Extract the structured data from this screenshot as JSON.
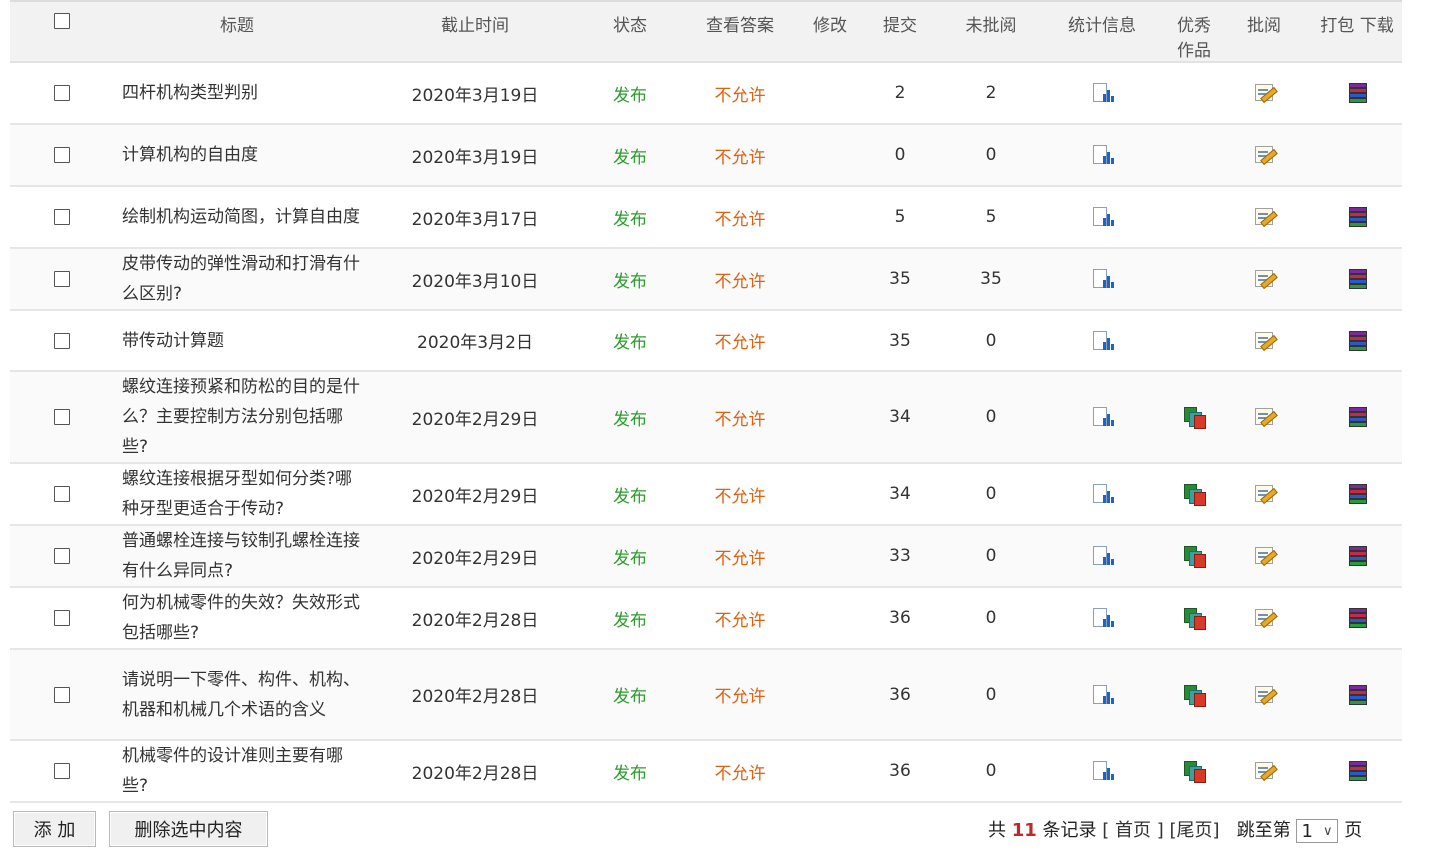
{
  "header": {
    "title": "标题",
    "deadline": "截止时间",
    "status": "状态",
    "view_answer": "查看答案",
    "edit": "修改",
    "submitted": "提交",
    "unreviewed": "未批阅",
    "stats": "统计信息",
    "excellent": "优秀作品",
    "review": "批阅",
    "pack": "打包 下载"
  },
  "rows": [
    {
      "title": "四杆机构类型判别",
      "deadline": "2020年3月19日",
      "status": "发布",
      "answer": "不允许",
      "submitted": "2",
      "unreviewed": "2",
      "excellent": false,
      "pack": true
    },
    {
      "title": "计算机构的自由度",
      "deadline": "2020年3月19日",
      "status": "发布",
      "answer": "不允许",
      "submitted": "0",
      "unreviewed": "0",
      "excellent": false,
      "pack": false
    },
    {
      "title": "绘制机构运动简图，计算自由度",
      "deadline": "2020年3月17日",
      "status": "发布",
      "answer": "不允许",
      "submitted": "5",
      "unreviewed": "5",
      "excellent": false,
      "pack": true
    },
    {
      "title": "皮带传动的弹性滑动和打滑有什么区别?",
      "deadline": "2020年3月10日",
      "status": "发布",
      "answer": "不允许",
      "submitted": "35",
      "unreviewed": "35",
      "excellent": false,
      "pack": true
    },
    {
      "title": "带传动计算题",
      "deadline": "2020年3月2日",
      "status": "发布",
      "answer": "不允许",
      "submitted": "35",
      "unreviewed": "0",
      "excellent": false,
      "pack": true
    },
    {
      "title": "螺纹连接预紧和防松的目的是什么？主要控制方法分别包括哪些?",
      "deadline": "2020年2月29日",
      "status": "发布",
      "answer": "不允许",
      "submitted": "34",
      "unreviewed": "0",
      "excellent": true,
      "pack": true
    },
    {
      "title": "螺纹连接根据牙型如何分类?哪种牙型更适合于传动?",
      "deadline": "2020年2月29日",
      "status": "发布",
      "answer": "不允许",
      "submitted": "34",
      "unreviewed": "0",
      "excellent": true,
      "pack": true
    },
    {
      "title": "普通螺栓连接与铰制孔螺栓连接有什么异同点?",
      "deadline": "2020年2月29日",
      "status": "发布",
      "answer": "不允许",
      "submitted": "33",
      "unreviewed": "0",
      "excellent": true,
      "pack": true
    },
    {
      "title": "何为机械零件的失效？失效形式包括哪些?",
      "deadline": "2020年2月28日",
      "status": "发布",
      "answer": "不允许",
      "submitted": "36",
      "unreviewed": "0",
      "excellent": true,
      "pack": true
    },
    {
      "title": "请说明一下零件、构件、机构、机器和机械几个术语的含义",
      "deadline": "2020年2月28日",
      "status": "发布",
      "answer": "不允许",
      "submitted": "36",
      "unreviewed": "0",
      "excellent": true,
      "pack": true
    },
    {
      "title": "机械零件的设计准则主要有哪些?",
      "deadline": "2020年2月28日",
      "status": "发布",
      "answer": "不允许",
      "submitted": "36",
      "unreviewed": "0",
      "excellent": true,
      "pack": true
    }
  ],
  "footer": {
    "add_label": "添 加",
    "delete_label": "删除选中内容",
    "total_prefix": "共",
    "total_count": "11",
    "total_suffix": "条记录",
    "first_page": "[ 首页 ]",
    "last_page": "[尾页]",
    "jump_prefix": "跳至第",
    "page_value": "1",
    "jump_suffix": "页"
  },
  "colors": {
    "status": "#2a9d2a",
    "answer": "#e06010",
    "total": "#c0282a"
  },
  "icons": {
    "stats": "stats-icon",
    "excellent": "excellent-work-icon",
    "review": "review-icon",
    "pack": "pack-download-icon"
  }
}
